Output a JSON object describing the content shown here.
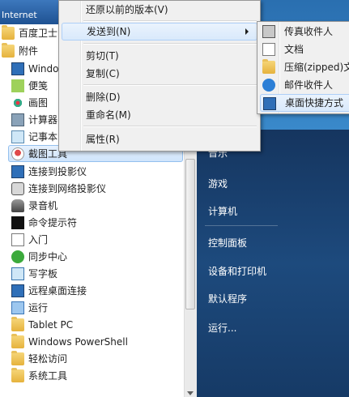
{
  "taskbar": {
    "label": "Internet"
  },
  "programs": [
    {
      "label": "百度卫士",
      "icon": "folder-icon"
    },
    {
      "label": "附件",
      "icon": "folder-icon"
    },
    {
      "label": "Windo",
      "icon": "monitor-icon"
    },
    {
      "label": "便笺",
      "icon": "sticky-note-icon"
    },
    {
      "label": "画图",
      "icon": "paint-icon"
    },
    {
      "label": "计算器",
      "icon": "calculator-icon"
    },
    {
      "label": "记事本",
      "icon": "notepad-icon"
    },
    {
      "label": "截图工具",
      "icon": "snipping-tool-icon",
      "selected": true
    },
    {
      "label": "连接到投影仪",
      "icon": "projector-icon"
    },
    {
      "label": "连接到网络投影仪",
      "icon": "network-projector-icon"
    },
    {
      "label": "录音机",
      "icon": "microphone-icon"
    },
    {
      "label": "命令提示符",
      "icon": "cmd-icon"
    },
    {
      "label": "入门",
      "icon": "getting-started-icon"
    },
    {
      "label": "同步中心",
      "icon": "sync-icon"
    },
    {
      "label": "写字板",
      "icon": "wordpad-icon"
    },
    {
      "label": "远程桌面连接",
      "icon": "remote-desktop-icon"
    },
    {
      "label": "运行",
      "icon": "run-icon"
    },
    {
      "label": "Tablet PC",
      "icon": "folder-icon"
    },
    {
      "label": "Windows PowerShell",
      "icon": "folder-icon"
    },
    {
      "label": "轻松访问",
      "icon": "folder-icon"
    },
    {
      "label": "系统工具",
      "icon": "folder-icon"
    }
  ],
  "right_panel": {
    "items": [
      "音乐",
      "游戏",
      "计算机",
      "控制面板",
      "设备和打印机",
      "默认程序",
      "运行..."
    ]
  },
  "context_menu": {
    "items": [
      "还原以前的版本(V)",
      "发送到(N)",
      "剪切(T)",
      "复制(C)",
      "删除(D)",
      "重命名(M)",
      "属性(R)"
    ]
  },
  "send_to_menu": {
    "items": [
      {
        "label": "传真收件人",
        "icon": "fax-icon"
      },
      {
        "label": "文档",
        "icon": "documents-icon"
      },
      {
        "label": "压缩(zipped)文",
        "icon": "zip-folder-icon"
      },
      {
        "label": "邮件收件人",
        "icon": "mail-icon"
      },
      {
        "label": "桌面快捷方式",
        "icon": "desktop-shortcut-icon",
        "selected": true
      }
    ]
  }
}
